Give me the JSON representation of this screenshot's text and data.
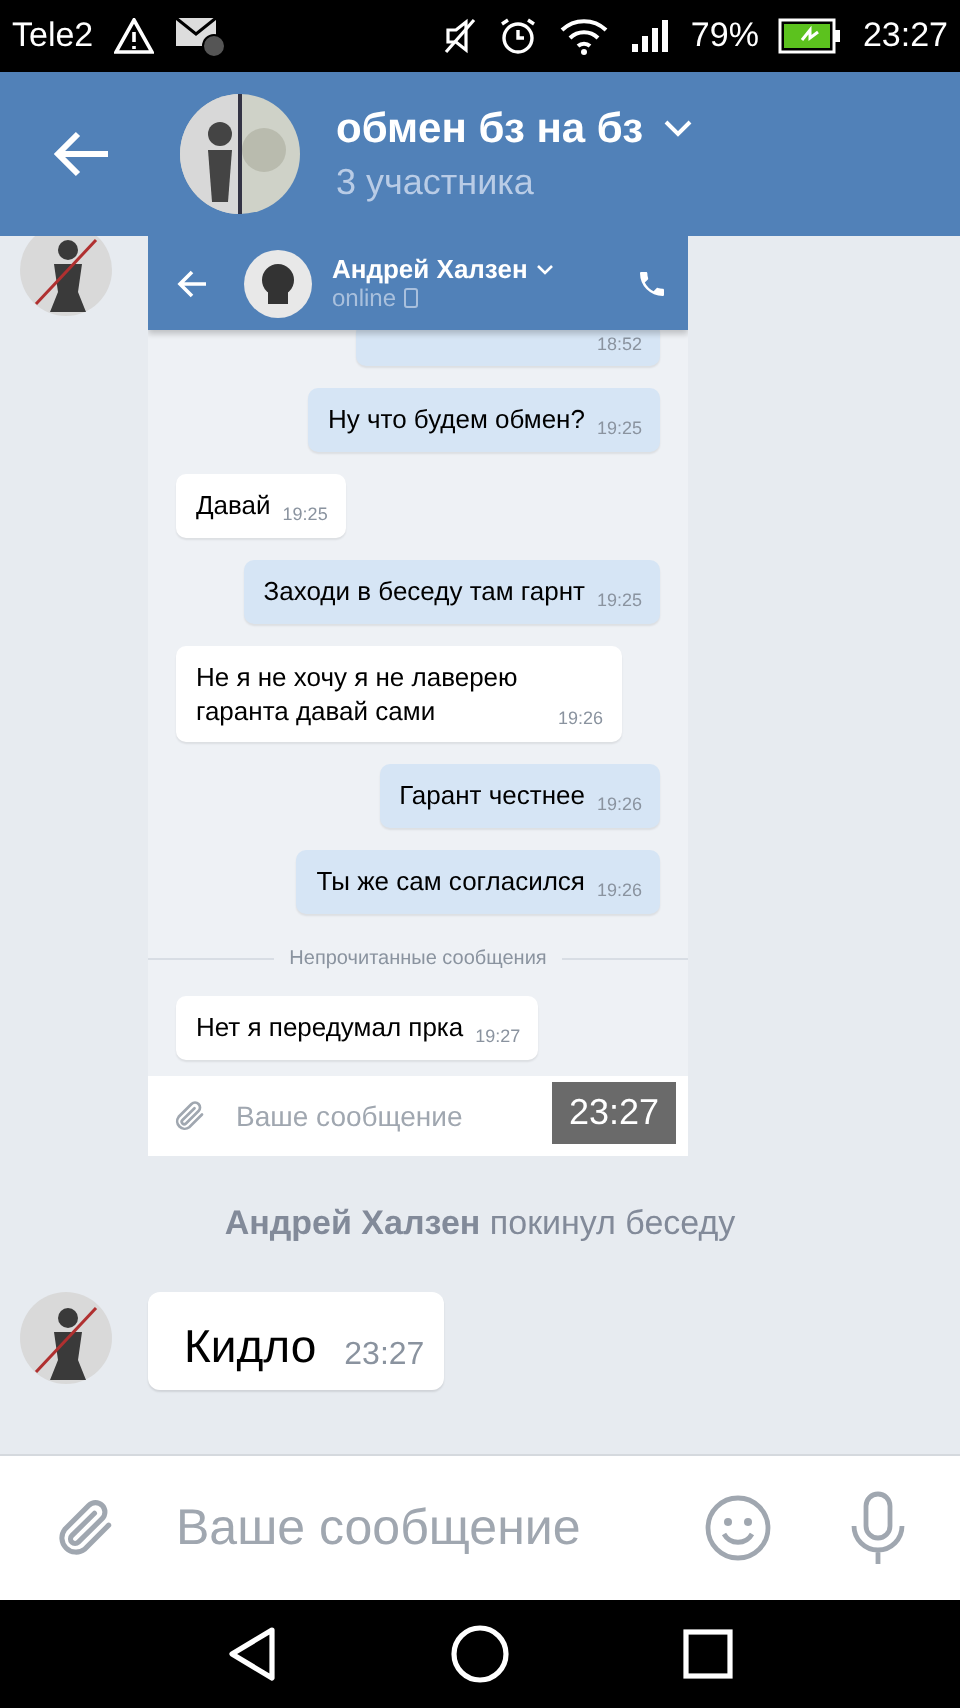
{
  "status_bar": {
    "carrier": "Tele2",
    "battery_percent": "79%",
    "time": "23:27"
  },
  "header": {
    "title": "обмен бз на бз",
    "subtitle": "3 участника"
  },
  "shared_screenshot": {
    "header": {
      "name": "Андрей Халзен",
      "status": "online"
    },
    "items": [
      {
        "kind": "cut",
        "time": "18:52"
      },
      {
        "kind": "out",
        "text": "Ну что будем обмен?",
        "time": "19:25"
      },
      {
        "kind": "in",
        "text": "Давай",
        "time": "19:25"
      },
      {
        "kind": "out",
        "text": "Заходи в беседу там гарнт",
        "time": "19:25"
      },
      {
        "kind": "in",
        "text": "Не я не хочу я не лаверею гаранта давай сами",
        "time": "19:26"
      },
      {
        "kind": "out",
        "text": "Гарант честнее",
        "time": "19:26"
      },
      {
        "kind": "out",
        "text": "Ты же сам согласился",
        "time": "19:26"
      },
      {
        "kind": "divider",
        "text": "Непрочитанные сообщения"
      },
      {
        "kind": "in",
        "text": "Нет я передумал прка",
        "time": "19:27"
      }
    ],
    "input": {
      "placeholder": "Ваше сообщение"
    },
    "overlay_time": "23:27"
  },
  "system_message": "**Андрей Халзен** покинул беседу",
  "message": {
    "text": "Кидло",
    "time": "23:27"
  },
  "composer": {
    "placeholder": "Ваше сообщение"
  }
}
